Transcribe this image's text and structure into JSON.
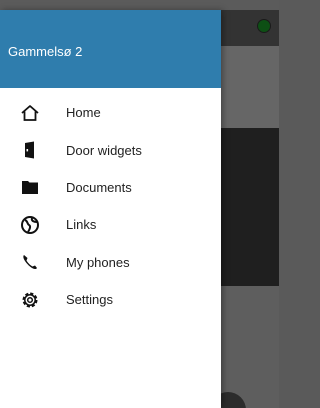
{
  "drawer": {
    "title": "Gammelsø 2",
    "header_color": "#2f7dad",
    "items": [
      {
        "label": "Home",
        "icon": "home-icon"
      },
      {
        "label": "Door widgets",
        "icon": "door-icon"
      },
      {
        "label": "Documents",
        "icon": "folder-icon"
      },
      {
        "label": "Links",
        "icon": "globe-icon"
      },
      {
        "label": "My phones",
        "icon": "phone-icon"
      },
      {
        "label": "Settings",
        "icon": "gear-icon"
      }
    ]
  },
  "background": {
    "status_dot_color": "#0d4f14"
  }
}
